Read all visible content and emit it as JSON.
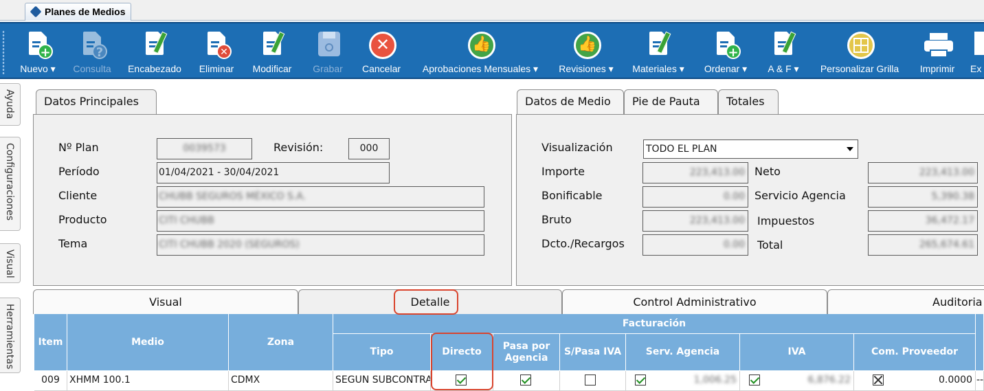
{
  "window_tab": {
    "title": "Planes de Medios"
  },
  "toolbar": {
    "buttons": [
      {
        "label": "Nuevo",
        "icon": "document-add-icon",
        "dropdown": true,
        "enabled": true
      },
      {
        "label": "Consulta",
        "icon": "document-query-icon",
        "dropdown": false,
        "enabled": false
      },
      {
        "label": "Encabezado",
        "icon": "document-edit-icon",
        "dropdown": false,
        "enabled": true
      },
      {
        "label": "Eliminar",
        "icon": "document-delete-icon",
        "dropdown": false,
        "enabled": true
      },
      {
        "label": "Modificar",
        "icon": "document-edit-icon",
        "dropdown": false,
        "enabled": true
      },
      {
        "label": "Grabar",
        "icon": "save-icon",
        "dropdown": false,
        "enabled": false
      },
      {
        "label": "Cancelar",
        "icon": "cancel-icon",
        "dropdown": false,
        "enabled": true
      },
      {
        "label": "Aprobaciones Mensuales",
        "icon": "thumbs-up-icon",
        "dropdown": true,
        "enabled": true
      },
      {
        "label": "Revisiones",
        "icon": "thumbs-up-icon",
        "dropdown": true,
        "enabled": true
      },
      {
        "label": "Materiales",
        "icon": "document-edit-icon",
        "dropdown": true,
        "enabled": true
      },
      {
        "label": "Ordenar",
        "icon": "document-add-icon",
        "dropdown": true,
        "enabled": true
      },
      {
        "label": "A & F",
        "icon": "document-edit-icon",
        "dropdown": true,
        "enabled": true
      },
      {
        "label": "Personalizar Grilla",
        "icon": "grid-icon",
        "dropdown": false,
        "enabled": true
      },
      {
        "label": "Imprimir",
        "icon": "printer-icon",
        "dropdown": false,
        "enabled": true
      },
      {
        "label": "Ex",
        "icon": "export-icon",
        "dropdown": false,
        "enabled": true
      }
    ],
    "dropdown_arrow": "▾"
  },
  "side_tabs": [
    "Ayuda",
    "Configuraciones",
    "Visual",
    "Herramientas"
  ],
  "datos_principales": {
    "tab_label": "Datos Principales",
    "nro_plan_label": "Nº Plan",
    "nro_plan_value": "0039573",
    "revision_label": "Revisión:",
    "revision_value": "000",
    "periodo_label": "Período",
    "periodo_value": "01/04/2021 - 30/04/2021",
    "cliente_label": "Cliente",
    "cliente_value": "CHUBB SEGUROS MÉXICO S.A.",
    "producto_label": "Producto",
    "producto_value": "CITI CHUBB",
    "tema_label": "Tema",
    "tema_value": "CITI CHUBB 2020 (SEGUROS)"
  },
  "right_panel": {
    "tabs": [
      "Datos de Medio",
      "Pie de Pauta",
      "Totales"
    ],
    "active_tab": "Totales",
    "visualizacion_label": "Visualización",
    "visualizacion_value": "TODO EL PLAN",
    "importe_label": "Importe",
    "importe_value": "223,413.00",
    "bonificable_label": "Bonificable",
    "bonificable_value": "0.00",
    "bruto_label": "Bruto",
    "bruto_value": "223,413.00",
    "dcto_label": "Dcto./Recargos",
    "dcto_value": "0.00",
    "neto_label": "Neto",
    "neto_value": "223,413.00",
    "servicio_label": "Servicio Agencia",
    "servicio_value": "5,390.38",
    "impuestos_label": "Impuestos",
    "impuestos_value": "36,472.17",
    "total_label": "Total",
    "total_value": "265,674.61"
  },
  "bottom_tabs": [
    "Visual",
    "Detalle",
    "Control Administrativo",
    "Auditoria"
  ],
  "active_bottom_tab": "Detalle",
  "grid": {
    "group_header": "Facturación",
    "columns": {
      "item": "Item",
      "medio": "Medio",
      "zona": "Zona",
      "tipo": "Tipo",
      "directo": "Directo",
      "pasa_por_agencia": "Pasa por Agencia",
      "s_pasa_iva": "S/Pasa IVA",
      "serv_agencia": "Serv. Agencia",
      "iva": "IVA",
      "com_proveedor": "Com. Proveedor"
    },
    "rows": [
      {
        "item": "009",
        "medio": "XHMM 100.1",
        "zona": "CDMX",
        "tipo": "SEGUN SUBCONTRATO",
        "directo": true,
        "pasa_por_agencia": true,
        "s_pasa_iva": false,
        "serv_agencia_check": true,
        "serv_agencia_value": "1,006.25",
        "iva_check": true,
        "iva_value": "6,876.22",
        "com_proveedor_check": "crossed",
        "com_proveedor_value": "0.0000",
        "trailing": "--"
      }
    ]
  },
  "colors": {
    "toolbar_bg": "#1d6eb4",
    "grid_header_bg": "#77aedc",
    "highlight": "#d9442d",
    "check_green": "#1e8f1e"
  }
}
